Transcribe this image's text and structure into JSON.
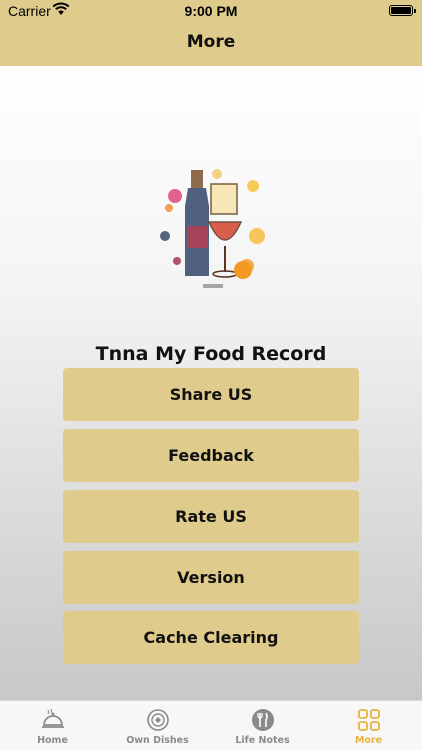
{
  "status_bar": {
    "carrier": "Carrier",
    "time": "9:00 PM",
    "wifi_icon": "wifi-icon",
    "battery_icon": "battery-icon"
  },
  "nav": {
    "title": "More"
  },
  "app": {
    "name": "Tnna My Food Record",
    "logo_icon": "wine-bottle-glass-logo",
    "logo_caption": "yingnbeee.com"
  },
  "menu": [
    {
      "label": "Share US"
    },
    {
      "label": "Feedback"
    },
    {
      "label": "Rate US"
    },
    {
      "label": "Version"
    },
    {
      "label": "Cache Clearing"
    }
  ],
  "tabs": [
    {
      "label": "Home",
      "icon": "cloche-icon",
      "active": false
    },
    {
      "label": "Own Dishes",
      "icon": "dish-icon",
      "active": false
    },
    {
      "label": "Life Notes",
      "icon": "fork-knife-icon",
      "active": false
    },
    {
      "label": "More",
      "icon": "grid-icon",
      "active": true
    }
  ],
  "colors": {
    "accent": "#dfcc8c",
    "active_tab": "#e6b23a",
    "inactive_tab": "#8a8a8a"
  }
}
